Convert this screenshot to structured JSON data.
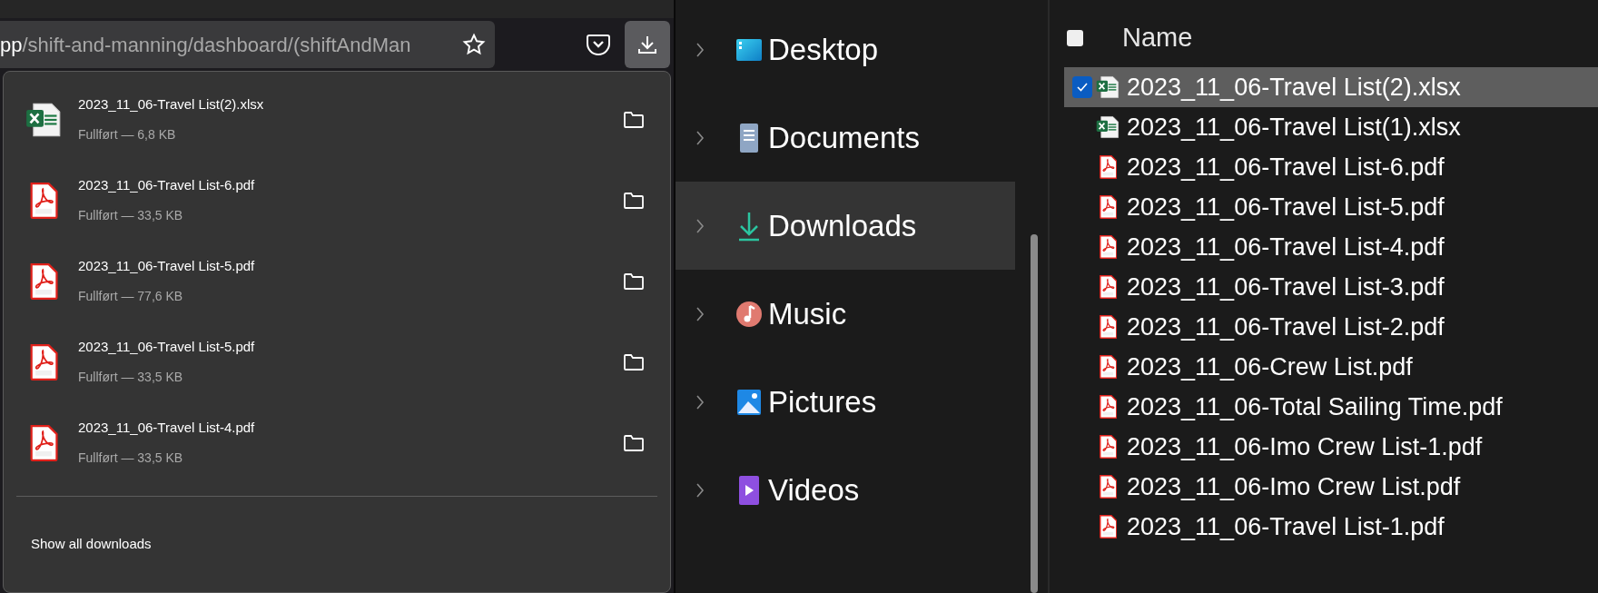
{
  "browser": {
    "url": {
      "host_tail": "pp",
      "path": "/shift-and-manning/dashboard/(shiftAndMan"
    },
    "downloads_button": {
      "selected": true
    }
  },
  "downloads_panel": {
    "items": [
      {
        "kind": "xlsx",
        "name": "2023_11_06-Travel List(2).xlsx",
        "status": "Fullført — 6,8 KB"
      },
      {
        "kind": "pdf",
        "name": "2023_11_06-Travel List-6.pdf",
        "status": "Fullført — 33,5 KB"
      },
      {
        "kind": "pdf",
        "name": "2023_11_06-Travel List-5.pdf",
        "status": "Fullført — 77,6 KB"
      },
      {
        "kind": "pdf",
        "name": "2023_11_06-Travel List-5.pdf",
        "status": "Fullført — 33,5 KB"
      },
      {
        "kind": "pdf",
        "name": "2023_11_06-Travel List-4.pdf",
        "status": "Fullført — 33,5 KB"
      }
    ],
    "show_all": "Show all downloads"
  },
  "explorer": {
    "sidebar": {
      "items": [
        {
          "kind": "desktop",
          "label": "Desktop",
          "selected": false
        },
        {
          "kind": "documents",
          "label": "Documents",
          "selected": false
        },
        {
          "kind": "downloads",
          "label": "Downloads",
          "selected": true
        },
        {
          "kind": "music",
          "label": "Music",
          "selected": false
        },
        {
          "kind": "pictures",
          "label": "Pictures",
          "selected": false
        },
        {
          "kind": "videos",
          "label": "Videos",
          "selected": false
        }
      ]
    },
    "files": {
      "header": {
        "label": "Name",
        "checked": false
      },
      "rows": [
        {
          "kind": "xlsx",
          "name": "2023_11_06-Travel List(2).xlsx",
          "selected": true,
          "checked": true
        },
        {
          "kind": "xlsx",
          "name": "2023_11_06-Travel List(1).xlsx",
          "selected": false,
          "checked": false
        },
        {
          "kind": "pdf",
          "name": "2023_11_06-Travel List-6.pdf",
          "selected": false,
          "checked": false
        },
        {
          "kind": "pdf",
          "name": "2023_11_06-Travel List-5.pdf",
          "selected": false,
          "checked": false
        },
        {
          "kind": "pdf",
          "name": "2023_11_06-Travel List-4.pdf",
          "selected": false,
          "checked": false
        },
        {
          "kind": "pdf",
          "name": "2023_11_06-Travel List-3.pdf",
          "selected": false,
          "checked": false
        },
        {
          "kind": "pdf",
          "name": "2023_11_06-Travel List-2.pdf",
          "selected": false,
          "checked": false
        },
        {
          "kind": "pdf",
          "name": "2023_11_06-Crew List.pdf",
          "selected": false,
          "checked": false
        },
        {
          "kind": "pdf",
          "name": "2023_11_06-Total Sailing Time.pdf",
          "selected": false,
          "checked": false
        },
        {
          "kind": "pdf",
          "name": "2023_11_06-Imo Crew List-1.pdf",
          "selected": false,
          "checked": false
        },
        {
          "kind": "pdf",
          "name": "2023_11_06-Imo Crew List.pdf",
          "selected": false,
          "checked": false
        },
        {
          "kind": "pdf",
          "name": "2023_11_06-Travel List-1.pdf",
          "selected": false,
          "checked": false
        }
      ]
    }
  }
}
